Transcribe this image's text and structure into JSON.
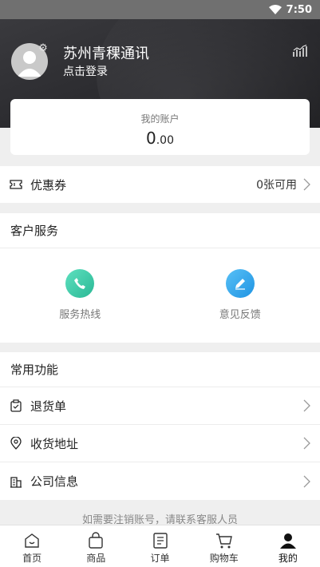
{
  "status_bar": {
    "time": "7:50",
    "wifi_icon": "wifi-icon"
  },
  "header": {
    "shop_name": "苏州青稞通讯",
    "login_label": "点击登录",
    "settings_icon": "gear-icon",
    "stats_icon": "bar-chart-icon"
  },
  "account": {
    "label": "我的账户",
    "balance_int": "0",
    "balance_dec": ".00"
  },
  "coupon": {
    "label": "优惠券",
    "value": "0张可用",
    "icon": "ticket-icon"
  },
  "customer_service": {
    "title": "客户服务",
    "items": [
      {
        "label": "服务热线",
        "icon": "phone-icon",
        "color": "#3cc8a6"
      },
      {
        "label": "意见反馈",
        "icon": "pencil-icon",
        "color": "#2ea4ec"
      }
    ]
  },
  "functions": {
    "title": "常用功能",
    "items": [
      {
        "label": "退货单",
        "icon": "clipboard-icon"
      },
      {
        "label": "收货地址",
        "icon": "location-pin-icon"
      },
      {
        "label": "公司信息",
        "icon": "building-icon"
      }
    ]
  },
  "footer_note": "如需要注销账号，请联系客服人员",
  "tabs": [
    {
      "label": "首页",
      "icon": "home-icon"
    },
    {
      "label": "商品",
      "icon": "bag-icon"
    },
    {
      "label": "订单",
      "icon": "order-list-icon"
    },
    {
      "label": "购物车",
      "icon": "cart-icon"
    },
    {
      "label": "我的",
      "icon": "person-icon",
      "active": true
    }
  ]
}
